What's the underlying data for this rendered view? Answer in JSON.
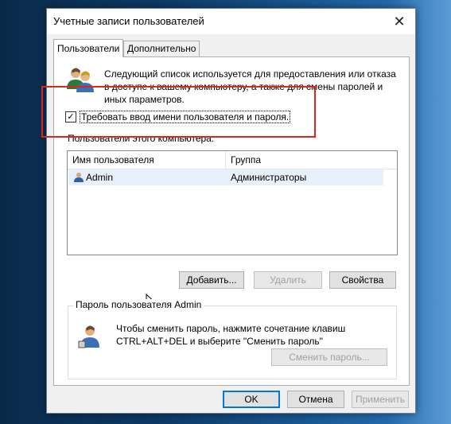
{
  "window": {
    "title": "Учетные записи пользователей",
    "close_glyph": "✕"
  },
  "tabs": [
    {
      "label": "Пользователи",
      "active": true
    },
    {
      "label": "Дополнительно",
      "active": false
    }
  ],
  "intro_text": "Следующий список используется для предоставления или отказа в доступе к вашему компьютеру, а также для смены паролей и иных параметров.",
  "require_password": {
    "label": "Требовать ввод имени пользователя и пароля.",
    "checked": true,
    "check_glyph": "✓"
  },
  "users_section_label": "Пользователи этого компьютера:",
  "users_table": {
    "columns": [
      "Имя пользователя",
      "Группа"
    ],
    "rows": [
      {
        "name": "Admin",
        "group": "Администраторы"
      }
    ]
  },
  "user_buttons": {
    "add": "Добавить...",
    "remove": "Удалить",
    "properties": "Свойства"
  },
  "password_group": {
    "title": "Пароль пользователя Admin",
    "text_line1": "Чтобы сменить пароль, нажмите сочетание клавиш",
    "text_line2": "CTRL+ALT+DEL и выберите \"Сменить пароль\"",
    "change_button": "Сменить пароль..."
  },
  "dialog_buttons": {
    "ok": "OK",
    "cancel": "Отмена",
    "apply": "Применить"
  },
  "icons": {
    "users": "users-icon",
    "user_row": "user-icon",
    "password_user": "user-key-icon",
    "cursor": "mouse-cursor-icon"
  },
  "colors": {
    "highlight": "#d9281b",
    "selection": "#e5f0fb",
    "default_button_border": "#0078d7"
  }
}
